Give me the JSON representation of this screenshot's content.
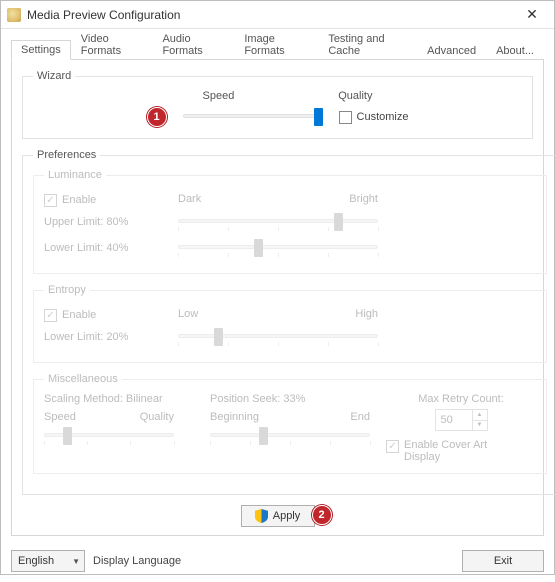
{
  "window": {
    "title": "Media Preview Configuration",
    "close_glyph": "✕"
  },
  "tabs": [
    {
      "label": "Settings",
      "active": true
    },
    {
      "label": "Video Formats"
    },
    {
      "label": "Audio Formats"
    },
    {
      "label": "Image Formats"
    },
    {
      "label": "Testing and Cache"
    },
    {
      "label": "Advanced"
    },
    {
      "label": "About..."
    }
  ],
  "wizard": {
    "legend": "Wizard",
    "speed_label": "Speed",
    "quality_label": "Quality",
    "customize_label": "Customize",
    "customize_checked": false,
    "slider_value": 100
  },
  "preferences": {
    "legend": "Preferences",
    "luminance": {
      "legend": "Luminance",
      "enable_label": "Enable",
      "enable_checked": true,
      "dark_label": "Dark",
      "bright_label": "Bright",
      "upper_limit_label": "Upper Limit: 80%",
      "upper_slider": 80,
      "lower_limit_label": "Lower Limit: 40%",
      "lower_slider": 40
    },
    "entropy": {
      "legend": "Entropy",
      "enable_label": "Enable",
      "enable_checked": true,
      "low_label": "Low",
      "high_label": "High",
      "lower_limit_label": "Lower Limit: 20%",
      "slider": 20
    },
    "misc": {
      "legend": "Miscellaneous",
      "scaling_label": "Scaling Method: Bilinear",
      "speed_label": "Speed",
      "quality_label": "Quality",
      "scaling_slider": 18,
      "position_seek_label": "Position Seek: 33%",
      "beginning_label": "Beginning",
      "end_label": "End",
      "position_slider": 33,
      "max_retry_label": "Max Retry Count:",
      "max_retry_value": "50",
      "cover_art_label": "Enable Cover Art Display",
      "cover_art_checked": true
    }
  },
  "apply_label": "Apply",
  "language": {
    "value": "English",
    "label": "Display Language"
  },
  "exit_label": "Exit",
  "markers": {
    "m1": "1",
    "m2": "2"
  }
}
